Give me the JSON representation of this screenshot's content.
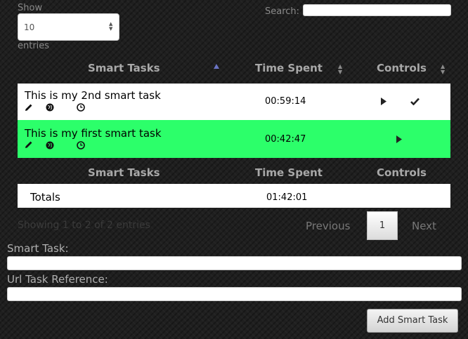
{
  "length_control": {
    "show_label": "Show",
    "selected": "10",
    "entries_label": "entries"
  },
  "search": {
    "label": "Search:",
    "value": ""
  },
  "table": {
    "headers": {
      "task": "Smart Tasks",
      "time": "Time Spent",
      "controls": "Controls"
    },
    "rows": [
      {
        "task": "This is my 2nd smart task",
        "time": "00:59:14",
        "highlighted": false
      },
      {
        "task": "This is my first smart task",
        "time": "00:42:47",
        "highlighted": true
      }
    ]
  },
  "totals": {
    "label": "Totals",
    "time": "01:42:01"
  },
  "info": "Showing 1 to 2 of 2 entries",
  "pagination": {
    "previous": "Previous",
    "current": "1",
    "next": "Next"
  },
  "form": {
    "smart_task_label": "Smart Task:",
    "smart_task_value": "",
    "url_label": "Url Task Reference:",
    "url_value": "",
    "add_button": "Add Smart Task"
  },
  "colors": {
    "highlight_row": "#2cff6a",
    "row": "#ffffff",
    "background": "#1f1f1f"
  }
}
